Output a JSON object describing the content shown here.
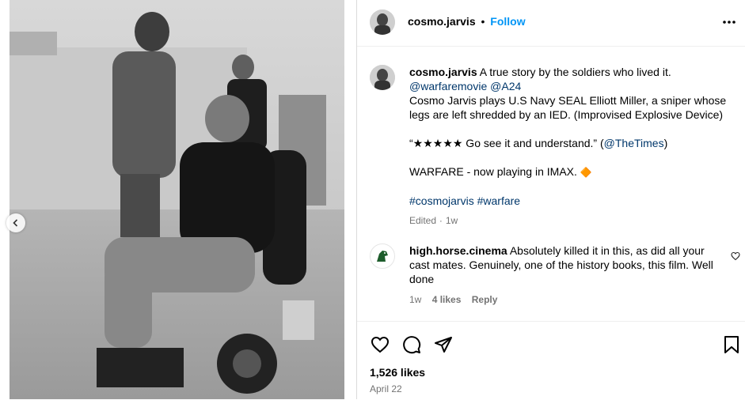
{
  "post": {
    "author": "cosmo.jarvis",
    "follow_label": "Follow",
    "separator": "•"
  },
  "caption": {
    "author": "cosmo.jarvis",
    "line1_text": "A true story by the soldiers who lived it.",
    "mention1": "@warfaremovie",
    "mention2": "@A24",
    "para1": "Cosmo Jarvis plays U.S Navy SEAL Elliott Miller, a sniper whose legs are left shredded by an IED. (Improvised Explosive Device)",
    "quote_text": "“★★★★★ Go see it and understand.” (",
    "quote_mention": "@TheTimes",
    "quote_close": ")",
    "warfare_text": "WARFARE - now playing in IMAX.",
    "warfare_emoji": "🔶",
    "hashtag1": "#cosmojarvis",
    "hashtag2": "#warfare",
    "edited": "Edited",
    "edited_sep": "·",
    "edited_time": "1w"
  },
  "comments": [
    {
      "username": "high.horse.cinema",
      "text": "Absolutely killed it in this, as did all your cast mates. Genuinely, one of the history books, this film. Well done",
      "time": "1w",
      "likes": "4 likes",
      "reply_label": "Reply"
    }
  ],
  "footer": {
    "likes": "1,526 likes",
    "date": "April 22"
  },
  "icons": {
    "more": "more-options-icon",
    "like": "heart-icon",
    "comment": "comment-icon",
    "share": "share-icon",
    "save": "bookmark-icon",
    "comment_like": "small-heart-icon",
    "prev": "chevron-left-icon"
  },
  "colors": {
    "accent": "#0095f6",
    "mention": "#00376b",
    "hashtag": "#3b5bdb",
    "muted": "#737373",
    "emoji_orange": "#e8632a"
  }
}
